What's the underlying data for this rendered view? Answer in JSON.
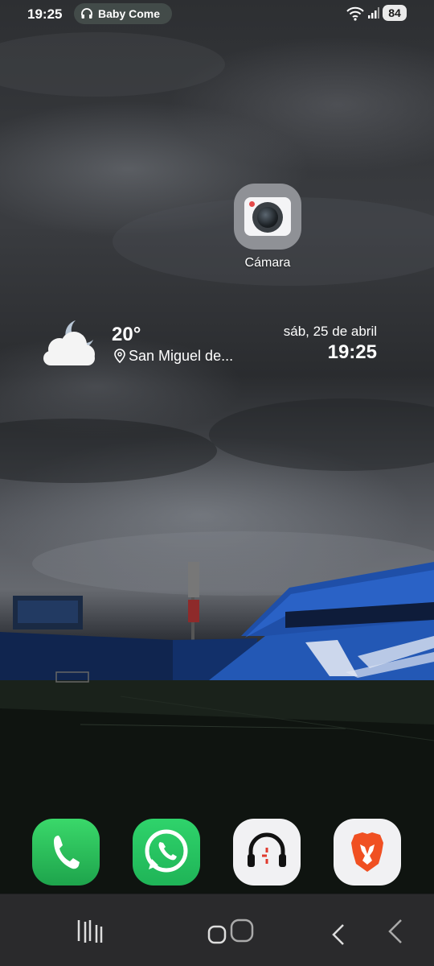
{
  "status_bar": {
    "time": "19:25",
    "media_notification": "Baby Come",
    "battery_level": "84"
  },
  "home_screen": {
    "apps": [
      {
        "label": "Cámara",
        "icon": "camera-icon"
      }
    ],
    "weather_widget": {
      "temperature": "20°",
      "location": "San Miguel de...",
      "date": "sáb, 25 de abril",
      "time": "19:25",
      "condition_icon": "partly-cloudy-night-icon"
    }
  },
  "dock": [
    {
      "name": "phone",
      "icon": "phone-icon",
      "color": "#27c05a"
    },
    {
      "name": "whatsapp",
      "icon": "whatsapp-icon",
      "color": "#25c463"
    },
    {
      "name": "headset-app",
      "icon": "headset-icon",
      "color": "#f1f1f3"
    },
    {
      "name": "brave",
      "icon": "brave-lion-icon",
      "color": "#f05022"
    }
  ],
  "navigation_bar": {
    "buttons": [
      "recents",
      "home",
      "back"
    ]
  }
}
